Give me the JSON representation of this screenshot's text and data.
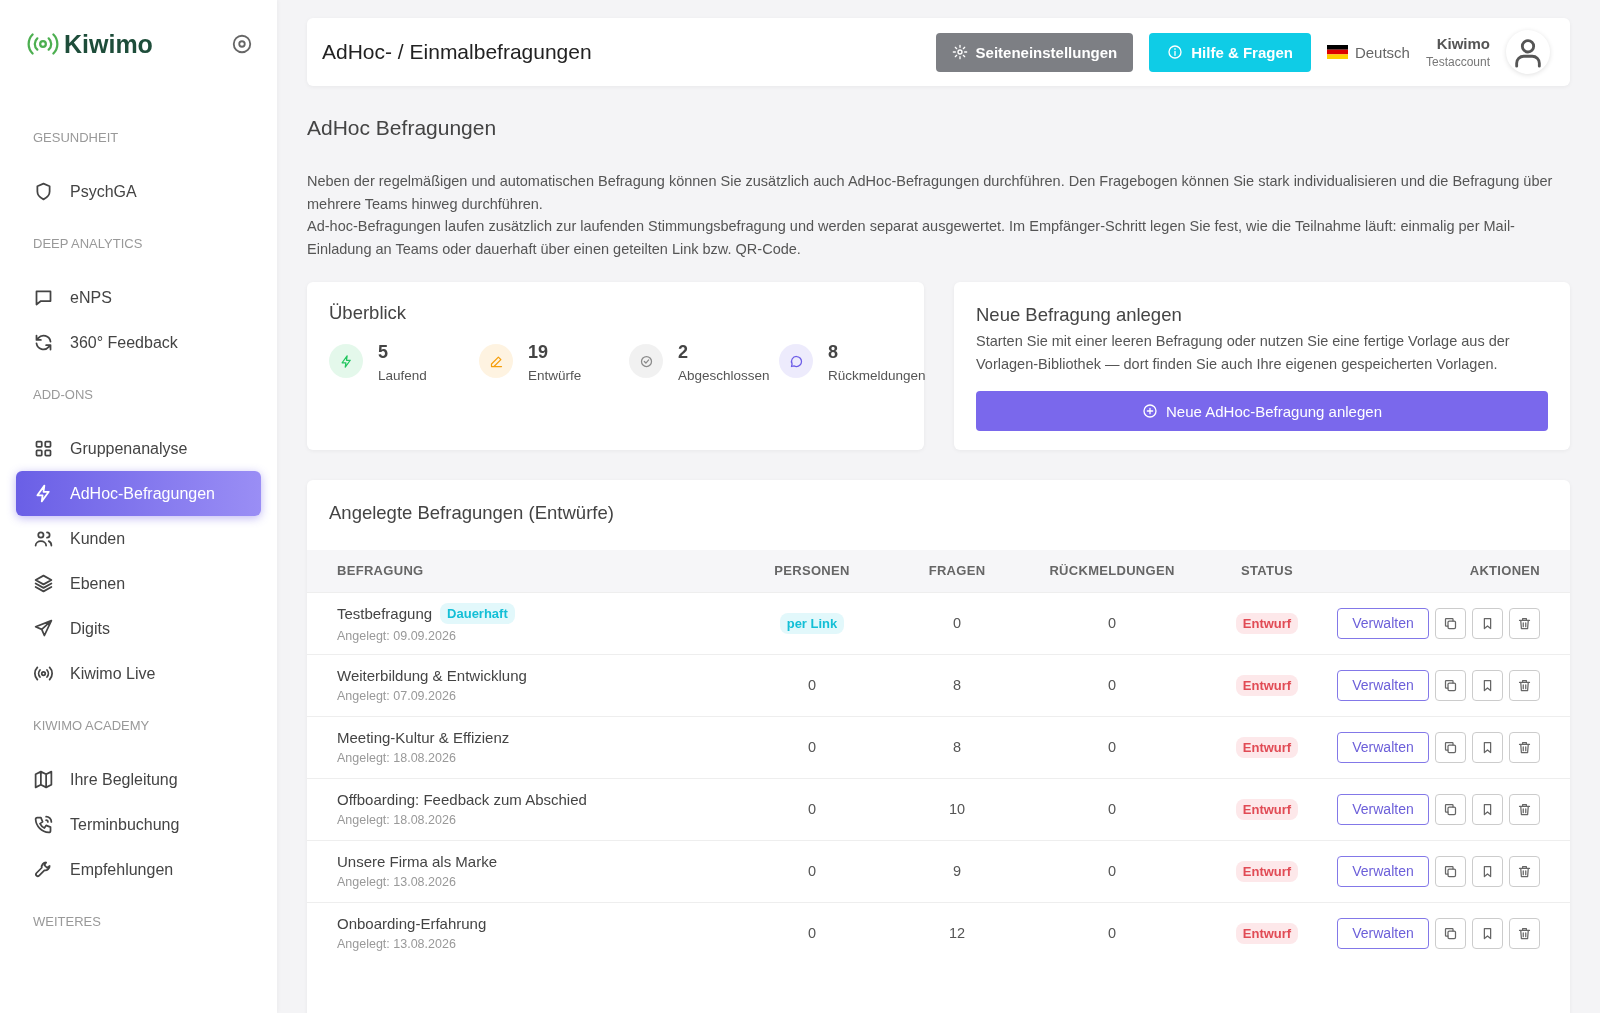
{
  "sidebar": {
    "logo": "Kiwimo",
    "sections": [
      {
        "heading": "GESUNDHEIT",
        "items": [
          {
            "label": "PsychGA",
            "selected": false
          }
        ]
      },
      {
        "heading": "DEEP ANALYTICS",
        "items": [
          {
            "label": "eNPS",
            "selected": false
          },
          {
            "label": "360° Feedback",
            "selected": false
          }
        ]
      },
      {
        "heading": "ADD-ONS",
        "items": [
          {
            "label": "Gruppenanalyse",
            "selected": false
          },
          {
            "label": "AdHoc-Befragungen",
            "selected": true
          },
          {
            "label": "Kunden",
            "selected": false
          },
          {
            "label": "Ebenen",
            "selected": false
          },
          {
            "label": "Digits",
            "selected": false
          },
          {
            "label": "Kiwimo Live",
            "selected": false
          }
        ]
      },
      {
        "heading": "KIWIMO ACADEMY",
        "items": [
          {
            "label": "Ihre Begleitung",
            "selected": false
          },
          {
            "label": "Terminbuchung",
            "selected": false
          },
          {
            "label": "Empfehlungen",
            "selected": false
          }
        ]
      },
      {
        "heading": "WEITERES"
      }
    ]
  },
  "header": {
    "title": "AdHoc- / Einmalbefragungen",
    "settings_button": "Seiteneinstellungen",
    "help_button": "Hilfe & Fragen",
    "language": "Deutsch",
    "user_name": "Kiwimo",
    "user_account": "Testaccount"
  },
  "page": {
    "title": "AdHoc Befragungen",
    "intro": [
      "Neben der regelmäßigen und automatischen Befragung können Sie zusätzlich auch AdHoc-Befragungen durchführen. Den Fragebogen können Sie stark individualisieren und die Befragung über mehrere Teams hinweg durchführen.",
      "Ad-hoc-Befragungen laufen zusätzlich zur laufenden Stimmungsbefragung und werden separat ausgewertet. Im Empfänger-Schritt legen Sie fest, wie die Teilnahme läuft: einmalig per Mail-Einladung an Teams oder dauerhaft über einen geteilten Link bzw. QR-Code."
    ]
  },
  "overview": {
    "title": "Überblick",
    "stats": [
      {
        "value": "5",
        "label": "Laufend",
        "color": "#22c55e"
      },
      {
        "value": "19",
        "label": "Entwürfe",
        "color": "#f59e0b"
      },
      {
        "value": "2",
        "label": "Abgeschlossen",
        "color": "#8a8a8a"
      },
      {
        "value": "8",
        "label": "Rückmeldungen",
        "color": "#6c5ce7"
      }
    ]
  },
  "new_survey": {
    "title": "Neue Befragung anlegen",
    "text": "Starten Sie mit einer leeren Befragung oder nutzen Sie eine fertige Vorlage aus der Vorlagen-Bibliothek — dort finden Sie auch Ihre eigenen gespeicherten Vorlagen.",
    "button": "Neue AdHoc-Befragung anlegen"
  },
  "table": {
    "title": "Angelegte Befragungen (Entwürfe)",
    "columns": [
      "BEFRAGUNG",
      "PERSONEN",
      "FRAGEN",
      "RÜCKMELDUNGEN",
      "STATUS",
      "AKTIONEN"
    ],
    "rows": [
      {
        "name": "Testbefragung",
        "tag": "Dauerhaft",
        "created": "Angelegt: 09.09.2026",
        "persons": {
          "kind": "badge",
          "text": "per Link"
        },
        "questions": "0",
        "responses": "0",
        "status": "Entwurf",
        "action": "Verwalten"
      },
      {
        "name": "Weiterbildung & Entwicklung",
        "created": "Angelegt: 07.09.2026",
        "persons": {
          "kind": "plain",
          "text": "0"
        },
        "questions": "8",
        "responses": "0",
        "status": "Entwurf",
        "action": "Verwalten"
      },
      {
        "name": "Meeting-Kultur & Effizienz",
        "created": "Angelegt: 18.08.2026",
        "persons": {
          "kind": "plain",
          "text": "0"
        },
        "questions": "8",
        "responses": "0",
        "status": "Entwurf",
        "action": "Verwalten"
      },
      {
        "name": "Offboarding: Feedback zum Abschied",
        "created": "Angelegt: 18.08.2026",
        "persons": {
          "kind": "plain",
          "text": "0"
        },
        "questions": "10",
        "responses": "0",
        "status": "Entwurf",
        "action": "Verwalten"
      },
      {
        "name": "Unsere Firma als Marke",
        "created": "Angelegt: 13.08.2026",
        "persons": {
          "kind": "plain",
          "text": "0"
        },
        "questions": "9",
        "responses": "0",
        "status": "Entwurf",
        "action": "Verwalten"
      },
      {
        "name": "Onboarding-Erfahrung",
        "created": "Angelegt: 13.08.2026",
        "persons": {
          "kind": "plain",
          "text": "0"
        },
        "questions": "12",
        "responses": "0",
        "status": "Entwurf",
        "action": "Verwalten"
      }
    ]
  }
}
